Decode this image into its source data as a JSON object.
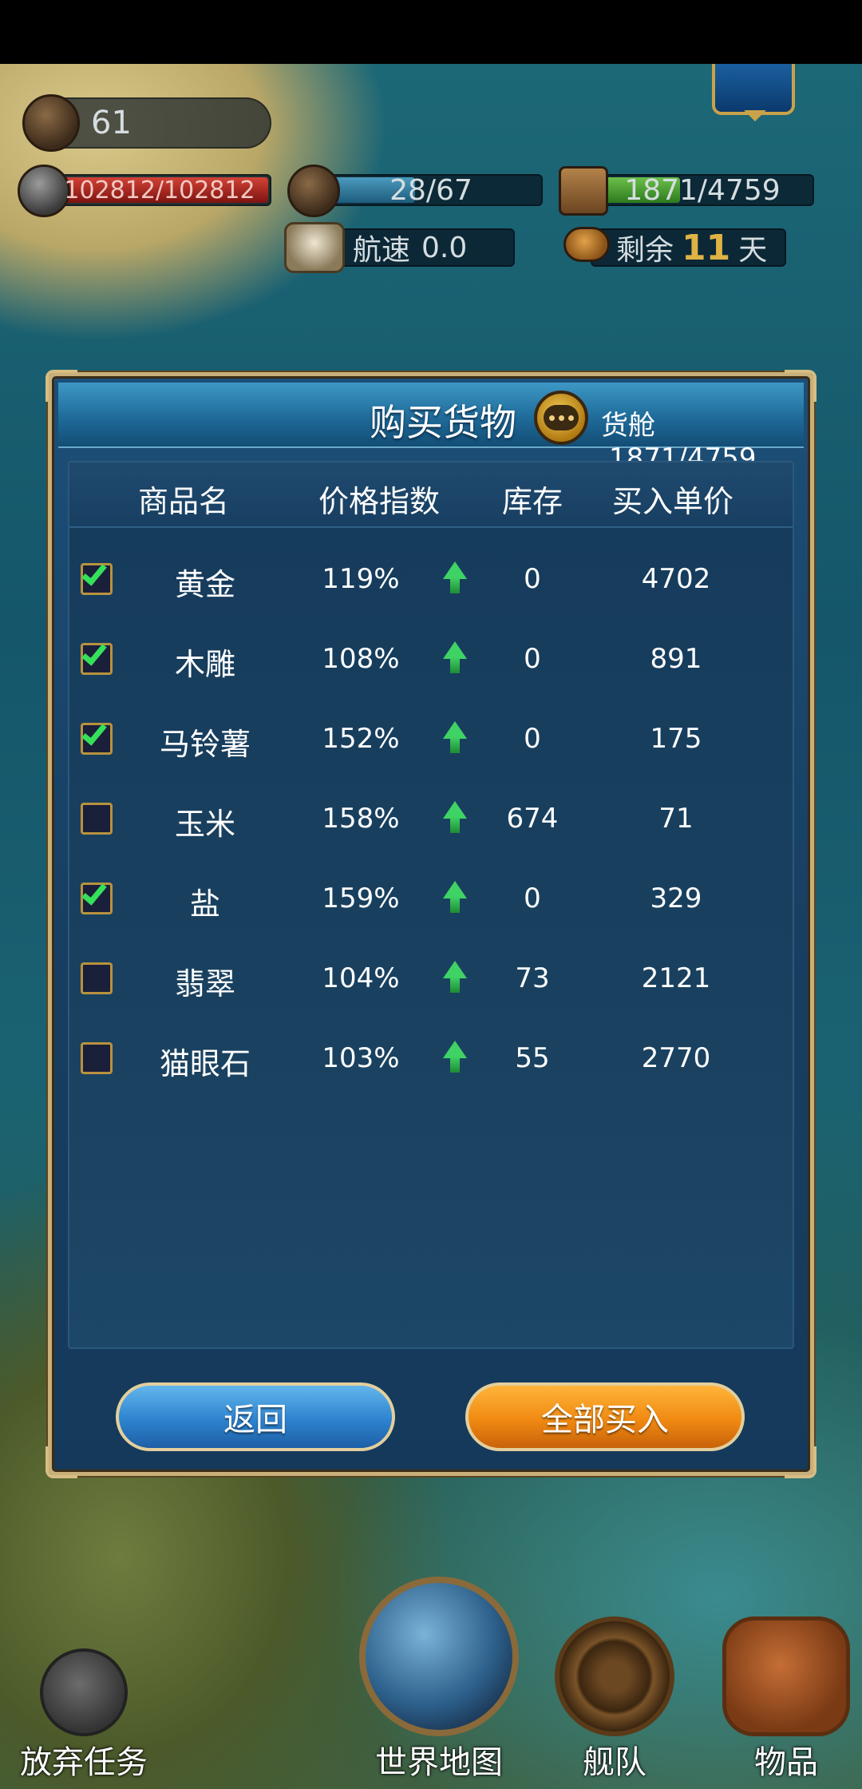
{
  "hud": {
    "level": "61",
    "hp": "102812/102812",
    "crew": "28/67",
    "cargo": "1871/4759",
    "speed_label": "航速",
    "speed_value": "0.0",
    "days_prefix": "剩余",
    "days_value": "11",
    "days_suffix": "天"
  },
  "dialog": {
    "title": "购买货物",
    "cargo_label": "货舱",
    "cargo_value": "1871/4759",
    "headers": [
      "商品名",
      "价格指数",
      "库存",
      "买入单价"
    ],
    "rows": [
      {
        "name": "黄金",
        "price_index": "119%",
        "trend": "up",
        "stock": "0",
        "unit_price": "4702",
        "checked": true
      },
      {
        "name": "木雕",
        "price_index": "108%",
        "trend": "up",
        "stock": "0",
        "unit_price": "891",
        "checked": true
      },
      {
        "name": "马铃薯",
        "price_index": "152%",
        "trend": "up",
        "stock": "0",
        "unit_price": "175",
        "checked": true
      },
      {
        "name": "玉米",
        "price_index": "158%",
        "trend": "up",
        "stock": "674",
        "unit_price": "71",
        "checked": false
      },
      {
        "name": "盐",
        "price_index": "159%",
        "trend": "up",
        "stock": "0",
        "unit_price": "329",
        "checked": true
      },
      {
        "name": "翡翠",
        "price_index": "104%",
        "trend": "up",
        "stock": "73",
        "unit_price": "2121",
        "checked": false
      },
      {
        "name": "猫眼石",
        "price_index": "103%",
        "trend": "up",
        "stock": "55",
        "unit_price": "2770",
        "checked": false
      }
    ],
    "back_label": "返回",
    "buy_all_label": "全部买入"
  },
  "nav": {
    "abandon": "放弃任务",
    "world_map": "世界地图",
    "fleet": "舰队",
    "items": "物品"
  },
  "colors": {
    "checkbox_tick": "#35e05a",
    "checkbox_border": "#b8923e",
    "back_button": "#2d83cf",
    "buy_all_button": "#f08a12",
    "trend_up": "#3fd264"
  }
}
